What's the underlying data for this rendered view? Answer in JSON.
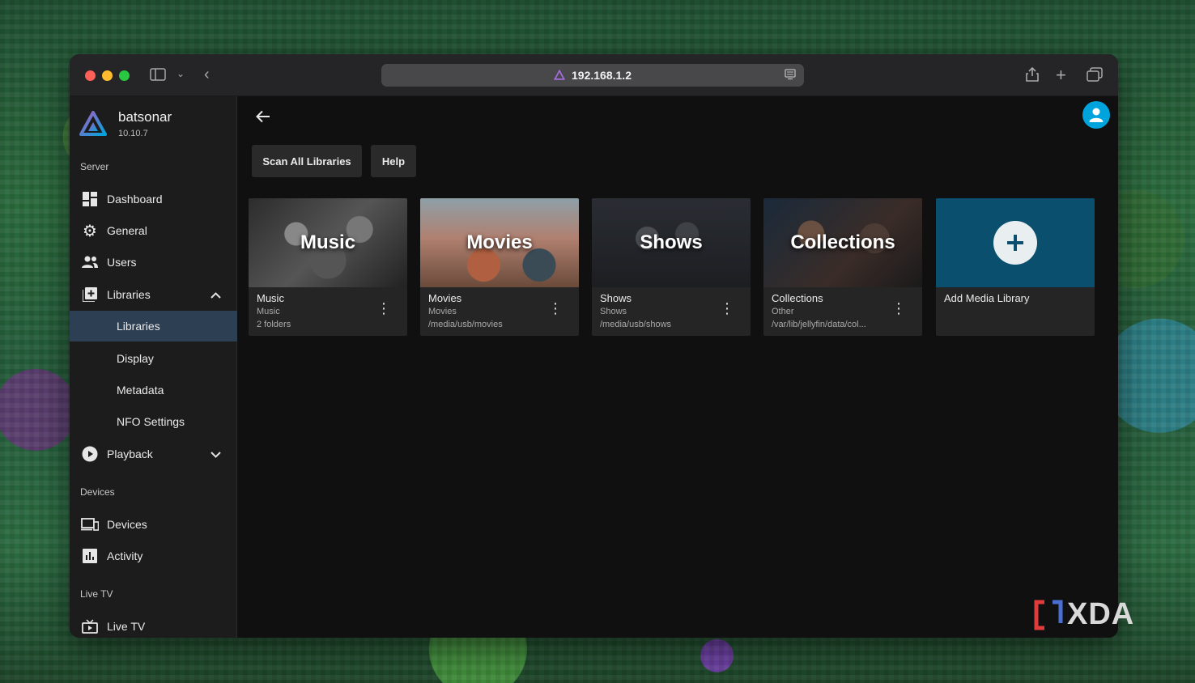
{
  "browser": {
    "url": "192.168.1.2"
  },
  "server": {
    "name": "batsonar",
    "version": "10.10.7"
  },
  "sidebar": {
    "section_server": "Server",
    "dashboard": "Dashboard",
    "general": "General",
    "users": "Users",
    "libraries": "Libraries",
    "libraries_sub": [
      "Libraries",
      "Display",
      "Metadata",
      "NFO Settings"
    ],
    "playback": "Playback",
    "section_devices": "Devices",
    "devices": "Devices",
    "activity": "Activity",
    "section_livetv": "Live TV",
    "livetv": "Live TV"
  },
  "toolbar": {
    "scan_all": "Scan All Libraries",
    "help": "Help"
  },
  "libraries": [
    {
      "thumb_title": "Music",
      "name": "Music",
      "type": "Music",
      "path": "2 folders"
    },
    {
      "thumb_title": "Movies",
      "name": "Movies",
      "type": "Movies",
      "path": "/media/usb/movies"
    },
    {
      "thumb_title": "Shows",
      "name": "Shows",
      "type": "Shows",
      "path": "/media/usb/shows"
    },
    {
      "thumb_title": "Collections",
      "name": "Collections",
      "type": "Other",
      "path": "/var/lib/jellyfin/data/col..."
    }
  ],
  "add_library": {
    "label": "Add Media Library"
  },
  "watermark": "XDA",
  "colors": {
    "accent": "#00a4dc",
    "active_nav": "#2d3f52",
    "add_tile": "#0a4f6e"
  }
}
